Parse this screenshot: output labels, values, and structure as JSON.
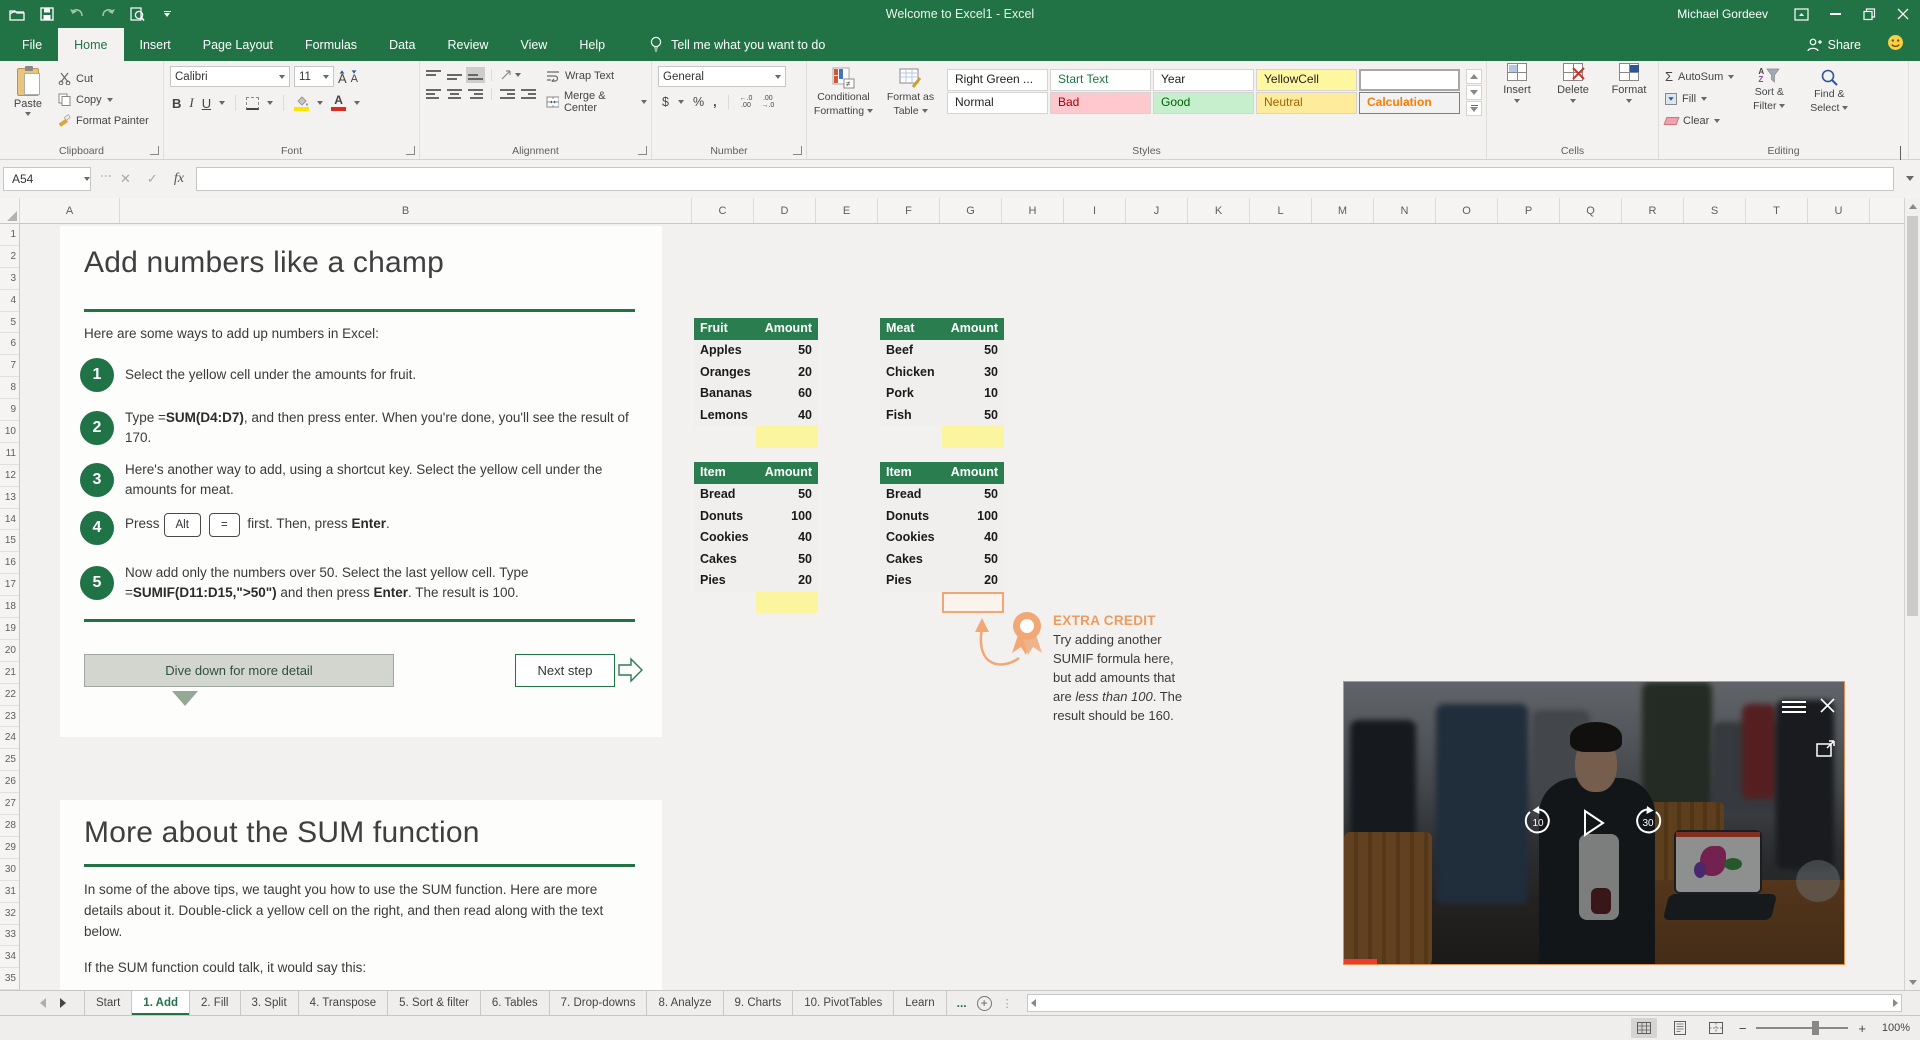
{
  "titlebar": {
    "title": "Welcome to Excel1  -  Excel",
    "user": "Michael Gordeev"
  },
  "ribbon_tabs": {
    "items": [
      {
        "label": "File",
        "kind": "file"
      },
      {
        "label": "Home",
        "kind": "active"
      },
      {
        "label": "Insert",
        "kind": "normal"
      },
      {
        "label": "Page Layout",
        "kind": "normal"
      },
      {
        "label": "Formulas",
        "kind": "normal"
      },
      {
        "label": "Data",
        "kind": "normal"
      },
      {
        "label": "Review",
        "kind": "normal"
      },
      {
        "label": "View",
        "kind": "normal"
      },
      {
        "label": "Help",
        "kind": "normal"
      }
    ],
    "tell_me": "Tell me what you want to do",
    "share_label": "Share"
  },
  "ribbon": {
    "clipboard": {
      "label": "Clipboard",
      "paste": "Paste",
      "cut": "Cut",
      "copy": "Copy",
      "format_painter": "Format Painter"
    },
    "font": {
      "label": "Font",
      "name": "Calibri",
      "size": "11",
      "bold": "B",
      "italic": "I",
      "underline": "U",
      "grow": "A",
      "shrink": "A"
    },
    "alignment": {
      "label": "Alignment",
      "wrap_text": "Wrap Text",
      "merge_center": "Merge & Center",
      "orient": "ab"
    },
    "number": {
      "label": "Number",
      "format": "General",
      "dollar": "$",
      "percent": "%",
      "comma": ",",
      "inc_dec": "←.0\n.00",
      "dec_dec": ".00\n→.0"
    },
    "styles": {
      "label": "Styles",
      "conditional_1": "Conditional",
      "conditional_2": "Formatting",
      "format_as_1": "Format as",
      "format_as_2": "Table",
      "gallery": [
        {
          "label": "Right Green ...",
          "kind": "plain"
        },
        {
          "label": "Start Text",
          "kind": "start-text"
        },
        {
          "label": "Year",
          "kind": "plain"
        },
        {
          "label": "YellowCell",
          "kind": "yellowcell"
        },
        {
          "label": "",
          "kind": "blank-selected"
        },
        {
          "label": "Normal",
          "kind": "plain"
        },
        {
          "label": "Bad",
          "kind": "bad"
        },
        {
          "label": "Good",
          "kind": "good"
        },
        {
          "label": "Neutral",
          "kind": "neutral"
        },
        {
          "label": "Calculation",
          "kind": "calculation"
        }
      ]
    },
    "cells": {
      "label": "Cells",
      "insert": "Insert",
      "delete": "Delete",
      "format": "Format"
    },
    "editing": {
      "label": "Editing",
      "autosum": "AutoSum",
      "sigma": "Σ",
      "fill": "Fill",
      "clear": "Clear",
      "sort_1": "Sort &",
      "sort_2": "Filter",
      "find_1": "Find &",
      "find_2": "Select",
      "sort_a": "A",
      "sort_z": "Z"
    }
  },
  "formula_bar": {
    "name_box": "A54",
    "fx": "fx",
    "formula": ""
  },
  "grid": {
    "columns": [
      "A",
      "B",
      "C",
      "D",
      "E",
      "F",
      "G",
      "H",
      "I",
      "J",
      "K",
      "L",
      "M",
      "N",
      "O",
      "P",
      "Q",
      "R",
      "S",
      "T",
      "U"
    ],
    "rows_start": 1,
    "rows_count": 35
  },
  "content": {
    "add_section": {
      "title": "Add numbers like a champ",
      "intro": "Here are some ways to add up numbers in Excel:",
      "steps": [
        {
          "num": "1",
          "text": "Select the yellow cell under the amounts for fruit."
        },
        {
          "num": "2",
          "pre": "Type =",
          "bold": "SUM(D4:D7)",
          "post": ", and then press enter. When you're done, you'll see the result of 170."
        },
        {
          "num": "3",
          "text": "Here's another way to add, using a shortcut key. Select the yellow cell under the amounts for meat."
        },
        {
          "num": "4",
          "pre": "Press",
          "key1": "Alt",
          "key2": "=",
          "mid": " first. Then, press ",
          "bold": "Enter",
          "post": "."
        },
        {
          "num": "5",
          "pre": "Now add only the numbers over 50. Select the last yellow cell. Type =",
          "bold": "SUMIF(D11:D15,\">50\")",
          "mid": " and then press ",
          "bold2": "Enter",
          "post": ". The result is 100."
        }
      ]
    },
    "buttons": {
      "dive": "Dive down for more detail",
      "next": "Next step"
    },
    "tables": [
      {
        "col1": "Fruit",
        "col2": "Amount",
        "rows": [
          [
            "Apples",
            "50"
          ],
          [
            "Oranges",
            "20"
          ],
          [
            "Bananas",
            "60"
          ],
          [
            "Lemons",
            "40"
          ]
        ],
        "result": "yellow"
      },
      {
        "col1": "Meat",
        "col2": "Amount",
        "rows": [
          [
            "Beef",
            "50"
          ],
          [
            "Chicken",
            "30"
          ],
          [
            "Pork",
            "10"
          ],
          [
            "Fish",
            "50"
          ]
        ],
        "result": "yellow"
      },
      {
        "col1": "Item",
        "col2": "Amount",
        "rows": [
          [
            "Bread",
            "50"
          ],
          [
            "Donuts",
            "100"
          ],
          [
            "Cookies",
            "40"
          ],
          [
            "Cakes",
            "50"
          ],
          [
            "Pies",
            "20"
          ]
        ],
        "result": "yellow"
      },
      {
        "col1": "Item",
        "col2": "Amount",
        "rows": [
          [
            "Bread",
            "50"
          ],
          [
            "Donuts",
            "100"
          ],
          [
            "Cookies",
            "40"
          ],
          [
            "Cakes",
            "50"
          ],
          [
            "Pies",
            "20"
          ]
        ],
        "result": "orange"
      }
    ],
    "extra_credit": {
      "heading": "EXTRA CREDIT",
      "line1": "Try adding another",
      "line2": "SUMIF formula here,",
      "line3": "but add amounts that",
      "line4_pre": "are ",
      "line4_italic": "less than 100",
      "line4_post": ". The",
      "line5": "result should be 160."
    },
    "sum_section": {
      "title": "More about the SUM function",
      "paragraph": "In some of the above tips, we taught you how to use the SUM function. Here are more details about it. Double-click a yellow cell on the right, and then read along with the text below.",
      "line": "If the SUM function could talk, it would say this:"
    }
  },
  "video": {
    "skip_back": "10",
    "skip_forward": "30"
  },
  "sheet_tabs": {
    "tabs": [
      "Start",
      "1. Add",
      "2. Fill",
      "3. Split",
      "4. Transpose",
      "5. Sort & filter",
      "6. Tables",
      "7. Drop-downs",
      "8. Analyze",
      "9. Charts",
      "10. PivotTables",
      "Learn"
    ],
    "active": "1. Add",
    "overflow": "..."
  },
  "status_bar": {
    "zoom": "100%"
  }
}
